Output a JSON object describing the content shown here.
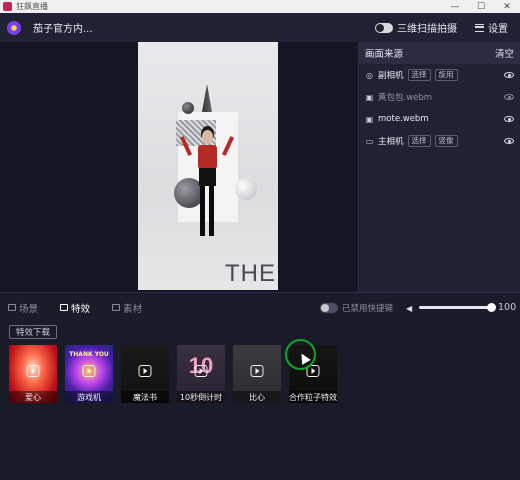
{
  "window": {
    "title": "狂飙直播",
    "controls": [
      "—",
      "☐",
      "✕"
    ]
  },
  "header": {
    "channel_name": "茄子官方内...",
    "qr_toggle_label": "三维扫描拍摄",
    "settings_label": "设置"
  },
  "preview": {
    "caption": "THE"
  },
  "sources": {
    "title": "画面来源",
    "clear_label": "清空",
    "items": [
      {
        "name": "副相机",
        "icon": "camera-icon",
        "chips": [
          "选择",
          "旋用"
        ],
        "dim": false
      },
      {
        "name": "黄包包.webm",
        "icon": "image-icon",
        "chips": [],
        "dim": true
      },
      {
        "name": "mote.webm",
        "icon": "image-icon",
        "chips": [],
        "dim": false
      },
      {
        "name": "主相机",
        "icon": "video-camera-icon",
        "chips": [
          "选择",
          "竖像"
        ],
        "dim": false
      }
    ]
  },
  "tabs": [
    {
      "label": "场景",
      "active": false
    },
    {
      "label": "特效",
      "active": true
    },
    {
      "label": "素材",
      "active": false
    }
  ],
  "shortcut": {
    "label": "已禁用快捷键"
  },
  "volume": {
    "value": "100",
    "level": 1.0
  },
  "effects": {
    "download_label": "特效下载",
    "items": [
      {
        "label": "爱心",
        "selected": false
      },
      {
        "label": "游戏机",
        "selected": true
      },
      {
        "label": "魔法书",
        "selected": false
      },
      {
        "label": "10秒倒计时",
        "selected": false
      },
      {
        "label": "比心",
        "selected": false
      },
      {
        "label": "合作粒子特效",
        "selected": false
      }
    ],
    "thumb_texts": {
      "game": "THANK YOU",
      "countdown": "10"
    }
  },
  "colors": {
    "accent": "#2c8fe0",
    "click_ring": "#0fa32b",
    "background": "#1b1c2a"
  }
}
